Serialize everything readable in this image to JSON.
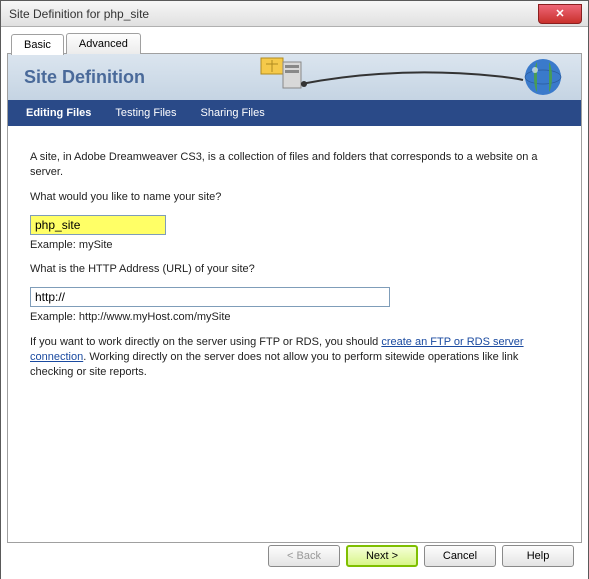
{
  "window": {
    "title": "Site Definition for php_site"
  },
  "tabs": {
    "basic": "Basic",
    "advanced": "Advanced"
  },
  "banner": {
    "title": "Site Definition"
  },
  "nav": {
    "editing": "Editing Files",
    "testing": "Testing Files",
    "sharing": "Sharing Files"
  },
  "content": {
    "intro": "A site, in Adobe Dreamweaver CS3, is a collection of files and folders that corresponds to a website on a server.",
    "name_label": "What would you like to name your site?",
    "name_value": "php_site",
    "name_example": "Example: mySite",
    "url_label": "What is the HTTP Address (URL) of your site?",
    "url_value": "http://",
    "url_example": "Example: http://www.myHost.com/mySite",
    "ftp_text_1": "If you want to work directly on the server using FTP or RDS, you should ",
    "ftp_link": "create an FTP or RDS server connection",
    "ftp_text_2": ".  Working directly on the server does not allow you to perform sitewide operations like link checking or site reports."
  },
  "buttons": {
    "back": "< Back",
    "next": "Next >",
    "cancel": "Cancel",
    "help": "Help"
  }
}
